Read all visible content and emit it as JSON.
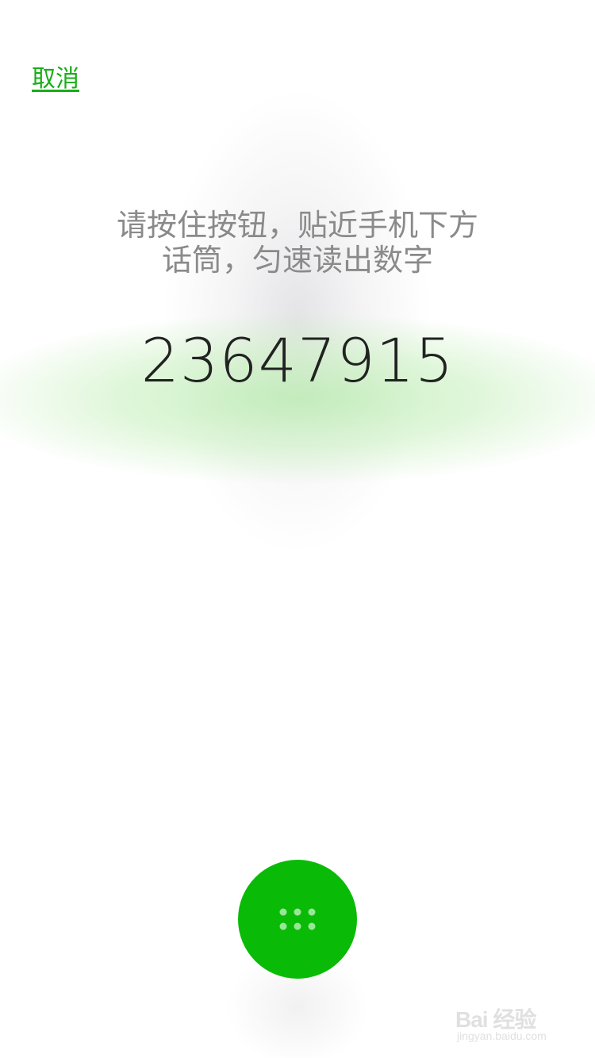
{
  "header": {
    "cancel_label": "取消"
  },
  "instruction": {
    "line1": "请按住按钮，贴近手机下方",
    "line2": "话筒，匀速读出数字"
  },
  "verification": {
    "digits": "23647915"
  },
  "talk_button": {
    "icon": "keypad-dots-icon"
  },
  "watermark": {
    "brand": "Bai 经验",
    "url": "jingyan.baidu.com"
  },
  "colors": {
    "accent": "#1aad19",
    "button": "#09bb07",
    "text_primary": "#222222",
    "text_secondary": "#8a8a8a"
  }
}
